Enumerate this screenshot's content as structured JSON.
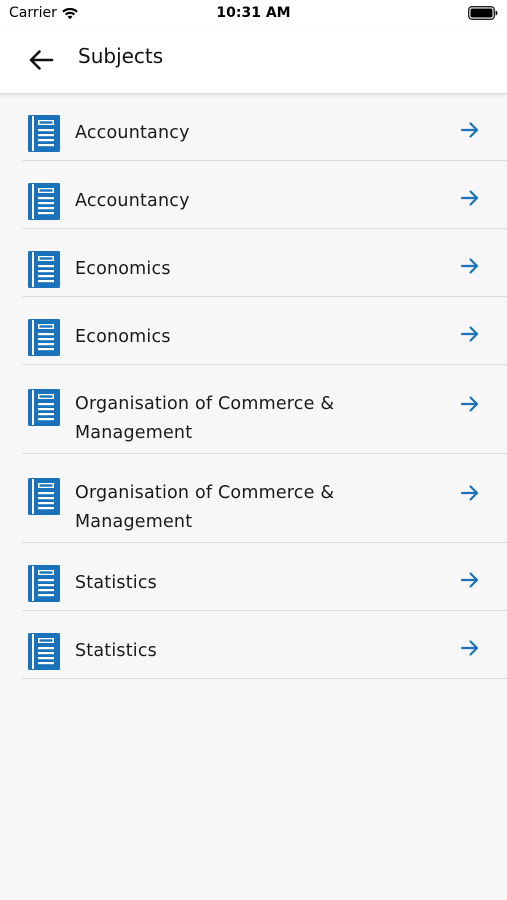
{
  "status_bar": {
    "carrier": "Carrier",
    "time": "10:31 AM",
    "wifi_icon": "wifi-icon",
    "battery_icon": "battery-icon"
  },
  "nav_bar": {
    "title": "Subjects",
    "back_icon": "arrow-left-icon"
  },
  "colors": {
    "accent": "#1a73ba",
    "background": "#f7f7f7",
    "divider": "#dcdcdc"
  },
  "subjects": [
    {
      "label": "Accountancy",
      "icon": "book-icon",
      "action_icon": "arrow-right-icon"
    },
    {
      "label": "Accountancy",
      "icon": "book-icon",
      "action_icon": "arrow-right-icon"
    },
    {
      "label": "Economics",
      "icon": "book-icon",
      "action_icon": "arrow-right-icon"
    },
    {
      "label": "Economics",
      "icon": "book-icon",
      "action_icon": "arrow-right-icon"
    },
    {
      "label": "Organisation of Commerce & Management",
      "icon": "book-icon",
      "action_icon": "arrow-right-icon"
    },
    {
      "label": "Organisation of Commerce & Management",
      "icon": "book-icon",
      "action_icon": "arrow-right-icon"
    },
    {
      "label": "Statistics",
      "icon": "book-icon",
      "action_icon": "arrow-right-icon"
    },
    {
      "label": "Statistics",
      "icon": "book-icon",
      "action_icon": "arrow-right-icon"
    }
  ]
}
